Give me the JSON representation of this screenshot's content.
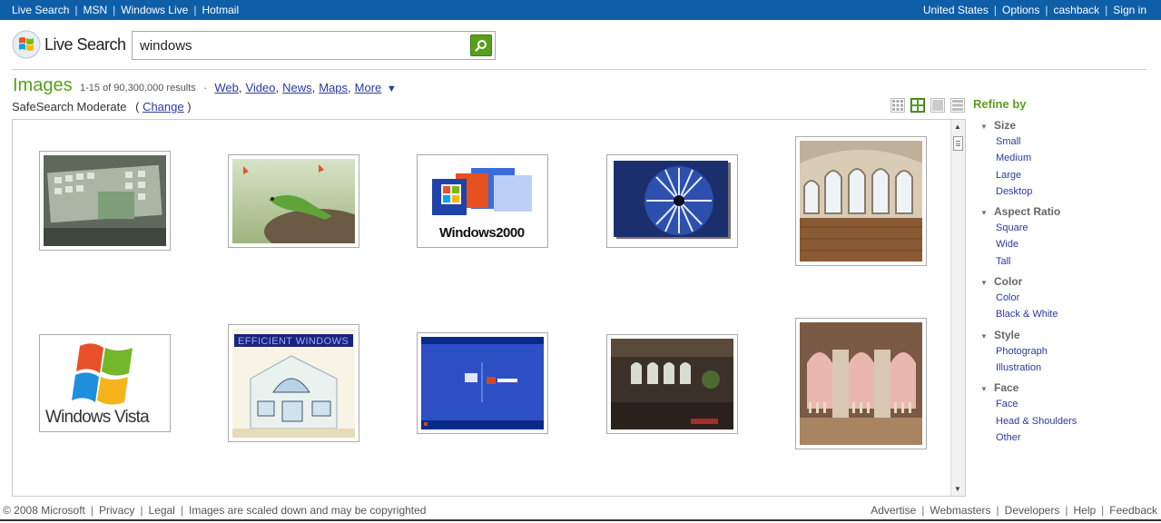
{
  "topbar": {
    "left_links": [
      "Live Search",
      "MSN",
      "Windows Live",
      "Hotmail"
    ],
    "right_links": [
      "United States",
      "Options",
      "cashback",
      "Sign in"
    ]
  },
  "header": {
    "logo_text": "Live Search",
    "search_value": "windows",
    "search_icon": "search-icon"
  },
  "results": {
    "title": "Images",
    "count": "1-15 of 90,300,000 results",
    "nav_links": [
      "Web",
      "Video",
      "News",
      "Maps",
      "More"
    ],
    "more_arrow": "▼",
    "safesearch_label": "SafeSearch Moderate",
    "safesearch_open": "(",
    "safesearch_change": "Change",
    "safesearch_close": ")"
  },
  "view_toggles": [
    "small-grid-icon",
    "medium-grid-icon",
    "large-view-icon",
    "detail-view-icon"
  ],
  "images": [
    {
      "name": "windows desktop screenshot",
      "color": "#6d7d6a"
    },
    {
      "name": "lizard on stump",
      "color": "#8aa064"
    },
    {
      "name": "microsoft windows 2000 logo",
      "color": "#d9e2f3"
    },
    {
      "name": "blue fractal wheel",
      "color": "#213a82"
    },
    {
      "name": "room with arched windows",
      "color": "#8a6340"
    },
    {
      "name": "windows vista logo",
      "color": "#ffffff"
    },
    {
      "name": "efficient windows sketch",
      "color": "#e8ecd8"
    },
    {
      "name": "windows xp login screen",
      "color": "#2b4fc2"
    },
    {
      "name": "room with tall windows",
      "color": "#3a3128"
    },
    {
      "name": "arched balcony windows",
      "color": "#9a7358"
    }
  ],
  "refine": {
    "title": "Refine by",
    "groups": [
      {
        "label": "Size",
        "items": [
          "Small",
          "Medium",
          "Large",
          "Desktop"
        ]
      },
      {
        "label": "Aspect Ratio",
        "items": [
          "Square",
          "Wide",
          "Tall"
        ]
      },
      {
        "label": "Color",
        "items": [
          "Color",
          "Black & White"
        ]
      },
      {
        "label": "Style",
        "items": [
          "Photograph",
          "Illustration"
        ]
      },
      {
        "label": "Face",
        "items": [
          "Face",
          "Head & Shoulders",
          "Other"
        ]
      }
    ]
  },
  "footer": {
    "left": [
      "© 2008 Microsoft",
      "Privacy",
      "Legal",
      "Images are scaled down and may be copyrighted"
    ],
    "right": [
      "Advertise",
      "Webmasters",
      "Developers",
      "Help",
      "Feedback"
    ]
  },
  "colors": {
    "topbar_blue": "#0e5fa8",
    "accent_green": "#5a9e1d",
    "link_blue": "#2a3b9a"
  }
}
